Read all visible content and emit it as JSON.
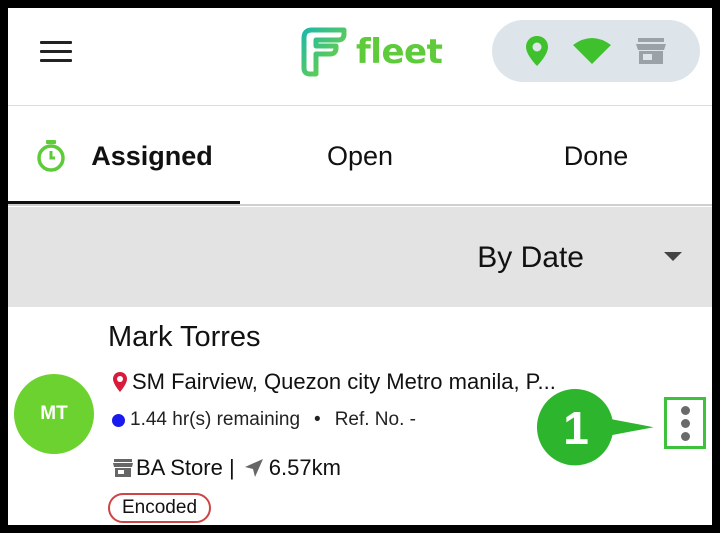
{
  "header": {
    "app_name": "fleet",
    "icons": [
      "menu-icon",
      "location-pin-icon",
      "wifi-icon",
      "store-icon"
    ]
  },
  "tabs": [
    {
      "label": "Assigned",
      "active": true,
      "icon": "stopwatch-icon"
    },
    {
      "label": "Open",
      "active": false
    },
    {
      "label": "Done",
      "active": false
    }
  ],
  "filter": {
    "label": "By Date",
    "icon": "caret-down-icon"
  },
  "card": {
    "initials": "MT",
    "name": "Mark Torres",
    "address": "SM Fairview, Quezon city Metro manila, P...",
    "remaining": "1.44 hr(s) remaining",
    "separator": "•",
    "ref_no": "Ref. No. -",
    "store": "BA Store",
    "store_separator": " | ",
    "distance": "6.57km",
    "status_badge": "Encoded"
  },
  "annotation": {
    "step_number": "1"
  },
  "colors": {
    "brand_green": "#5ecb3a",
    "avatar_green": "#6cd22f",
    "callout_green": "#2db52d",
    "status_dot_blue": "#1a1aee",
    "badge_border": "#cc4444",
    "pin_red": "#d81b3c"
  }
}
